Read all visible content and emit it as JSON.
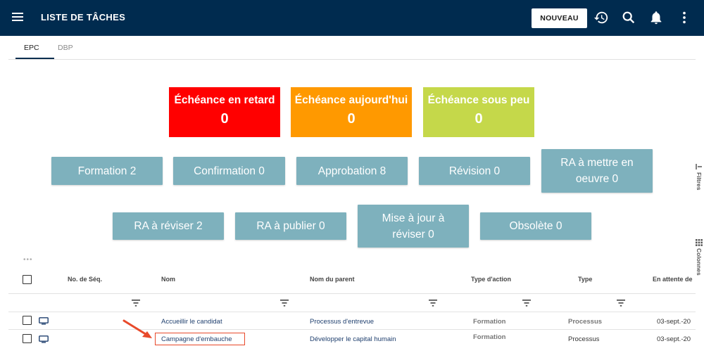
{
  "header": {
    "title": "LISTE DE TÂCHES",
    "new_button": "NOUVEAU"
  },
  "tabs": [
    {
      "label": "EPC",
      "active": true
    },
    {
      "label": "DBP",
      "active": false
    }
  ],
  "status_cards": [
    {
      "title": "Échéance en retard",
      "value": "0",
      "color": "#ff0000"
    },
    {
      "title": "Échéance aujourd'hui",
      "value": "0",
      "color": "#ff9900"
    },
    {
      "title": "Échéance sous peu",
      "value": "0",
      "color": "#c5d84a"
    }
  ],
  "filter_buttons_row1": [
    {
      "label": "Formation 2"
    },
    {
      "label": "Confirmation 0"
    },
    {
      "label": "Approbation 8"
    },
    {
      "label": "Révision 0"
    },
    {
      "label": "RA à mettre en oeuvre 0"
    }
  ],
  "filter_buttons_row2": [
    {
      "label": "RA à réviser 2"
    },
    {
      "label": "RA à publier 0"
    },
    {
      "label": "Mise à jour à réviser 0"
    },
    {
      "label": "Obsolète 0"
    }
  ],
  "side_panel": {
    "filters": "Filtres",
    "columns": "Colonnes"
  },
  "table": {
    "columns": [
      "No. de Séq.",
      "Nom",
      "Nom du parent",
      "Type d'action",
      "Type",
      "En attente de"
    ],
    "rows": [
      {
        "seq": "",
        "name": "Accueillir le candidat",
        "parent": "Processus d'entrevue",
        "action": "Formation",
        "type": "Processus",
        "waiting": "03-sept.-20"
      },
      {
        "seq": "",
        "name": "Campagne d'embauche",
        "parent": "Développer le capital humain",
        "action": "Formation",
        "type": "Processus",
        "waiting": "03-sept.-20"
      }
    ]
  },
  "colors": {
    "topbar": "#002b4f",
    "filter_button": "#7eb1bd",
    "highlight": "#e84a2b"
  }
}
